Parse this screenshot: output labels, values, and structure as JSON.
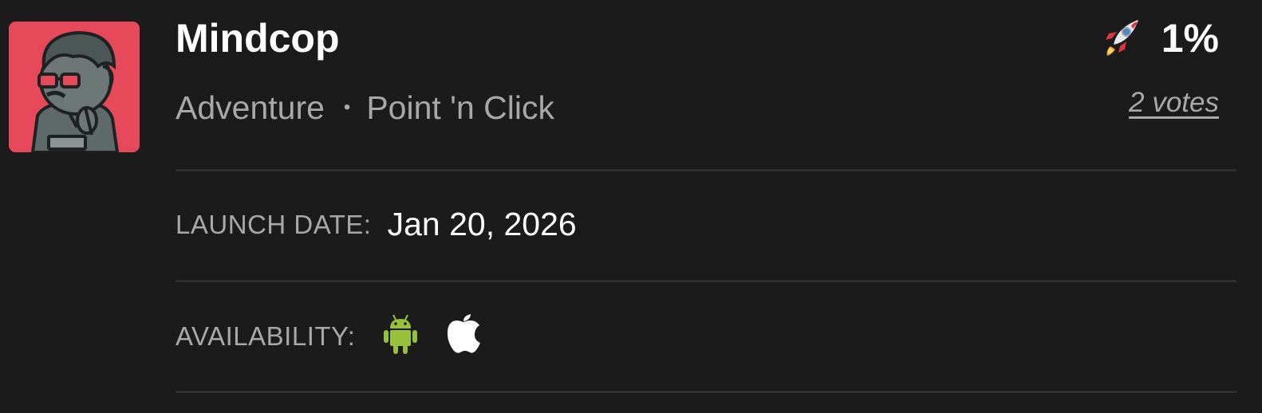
{
  "app": {
    "title": "Mindcop",
    "genres": [
      "Adventure",
      "Point 'n Click"
    ],
    "separator": "•",
    "icon": "detective-character-icon"
  },
  "rating": {
    "icon": "rocket-icon",
    "percent": "1%",
    "votes": "2 votes"
  },
  "details": {
    "launch_label": "LAUNCH DATE:",
    "launch_value": "Jan 20, 2026",
    "availability_label": "AVAILABILITY:",
    "platforms": [
      "android-icon",
      "apple-icon"
    ]
  },
  "colors": {
    "background": "#1b1b1b",
    "icon_bg": "#e5495a",
    "android": "#97c03d",
    "text_muted": "#a8a8a8",
    "text_primary": "#ffffff"
  }
}
